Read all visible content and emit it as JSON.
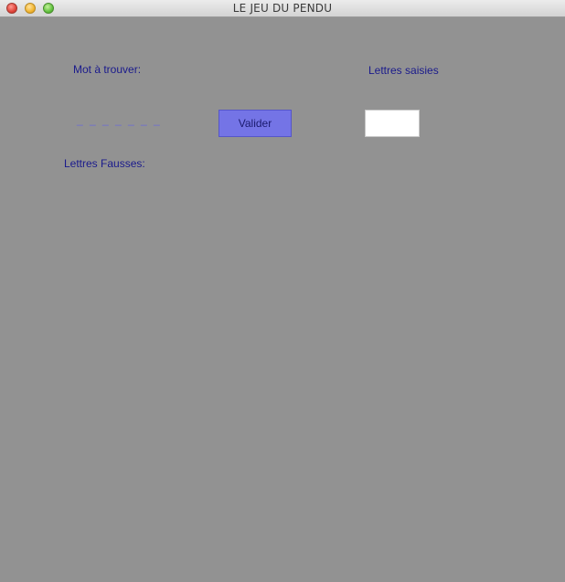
{
  "window": {
    "title": "LE JEU DU PENDU"
  },
  "game": {
    "mot_label": "Mot à trouver:",
    "masked_word": "_ _ _ _ _ _ _",
    "lettres_saisies_label": "Lettres saisies",
    "lettres_fausses_label": "Lettres Fausses:",
    "valider_label": "Valider",
    "letter_input_value": ""
  },
  "colors": {
    "background": "#929292",
    "label_text": "#1a1a8c",
    "button_fill": "#7474e6",
    "masked_word": "#6b6bd6"
  }
}
